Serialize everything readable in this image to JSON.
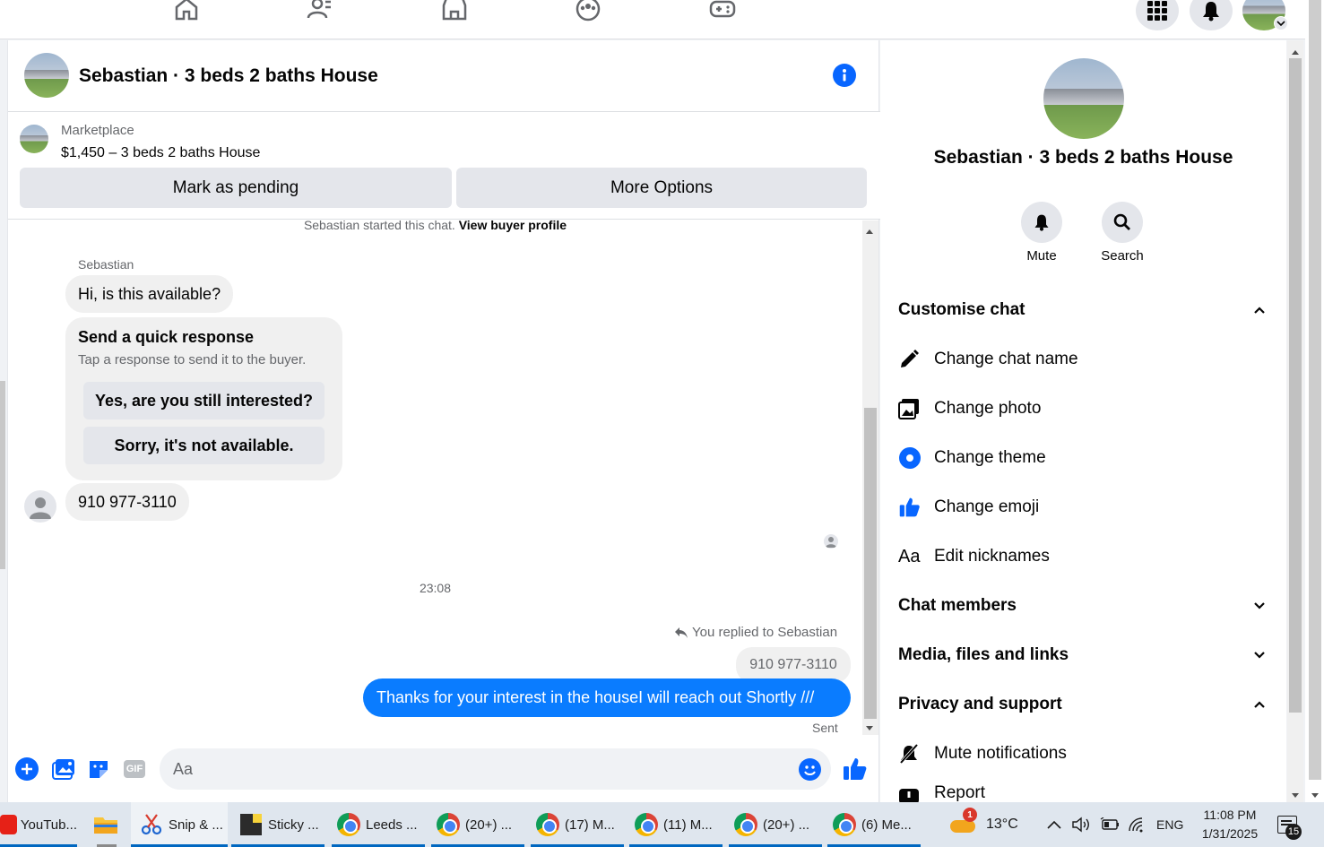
{
  "chat": {
    "title": "Sebastian · 3 beds 2 baths House",
    "listing_source": "Marketplace",
    "listing_title": "$1,450 – 3 beds 2 baths House",
    "mark_pending": "Mark as pending",
    "more_options": "More Options",
    "started_text": "Sebastian started this chat.",
    "view_profile": "View buyer profile",
    "sender_name": "Sebastian",
    "msg_available": "Hi, is this available?",
    "quick_title": "Send a quick response",
    "quick_subtitle": "Tap a response to send it to the buyer.",
    "quick_reply_1": "Yes, are you still interested?",
    "quick_reply_2": "Sorry, it's not available.",
    "msg_phone": "910 977-3110",
    "timestamp": "23:08",
    "replied_label": "You replied to Sebastian",
    "quoted_text": "910 977-3110",
    "sent_message": "Thanks for your interest in the houseI will reach out Shortly ///",
    "sent_status": "Sent",
    "composer_placeholder": "Aa"
  },
  "info": {
    "title": "Sebastian · 3 beds 2 baths House",
    "mute_label": "Mute",
    "search_label": "Search",
    "customise_chat": "Customise chat",
    "change_chat_name": "Change chat name",
    "change_photo": "Change photo",
    "change_theme": "Change theme",
    "change_emoji": "Change emoji",
    "edit_nicknames_icon_text": "Aa",
    "edit_nicknames": "Edit nicknames",
    "chat_members": "Chat members",
    "media_files_links": "Media, files and links",
    "privacy_support": "Privacy and support",
    "mute_notifications": "Mute notifications",
    "report": "Report"
  },
  "taskbar": {
    "items": [
      "YouTub...",
      "Snip & ...",
      "Sticky ...",
      "Leeds ...",
      "(20+) ...",
      "(17) M...",
      "(11) M...",
      "(20+) ...",
      "(6) Me..."
    ],
    "weather_badge": "1",
    "temperature": "13°C",
    "language": "ENG",
    "time": "11:08 PM",
    "date": "1/31/2025",
    "notification_count": "15"
  },
  "colors": {
    "accent": "#0866ff",
    "sent_bubble": "#0a7cff",
    "gray_bubble": "#f0f0f0",
    "button_gray": "#e4e6eb"
  }
}
